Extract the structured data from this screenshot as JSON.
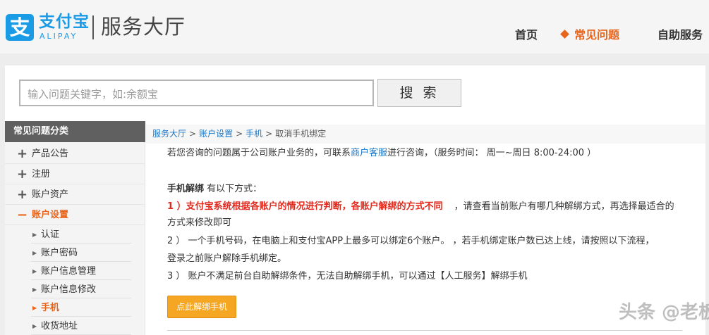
{
  "header": {
    "logo_mark": "支",
    "logo_cn": "支付宝",
    "logo_en": "ALIPAY",
    "title": "服务大厅",
    "nav": {
      "home": "首页",
      "faq": "常见问题",
      "self_service": "自助服务"
    }
  },
  "search": {
    "placeholder": "输入问题关键字，如:余额宝",
    "button": "搜 索"
  },
  "sidebar": {
    "heading": "常见问题分类",
    "items": [
      {
        "icon": "plus-icon",
        "mark": "+",
        "label": "产品公告"
      },
      {
        "icon": "plus-icon",
        "mark": "+",
        "label": "注册"
      },
      {
        "icon": "plus-icon",
        "mark": "+",
        "label": "账户资产"
      },
      {
        "icon": "minus-icon",
        "mark": "−",
        "label": "账户设置"
      }
    ],
    "sub_items": [
      {
        "mark": "▶",
        "label": "认证"
      },
      {
        "mark": "▶",
        "label": "账户密码"
      },
      {
        "mark": "▶",
        "label": "账户信息管理"
      },
      {
        "mark": "▶",
        "label": "账户信息修改"
      },
      {
        "mark": "▶",
        "label": "手机"
      },
      {
        "mark": "▶",
        "label": "收货地址"
      }
    ]
  },
  "breadcrumb": {
    "items": [
      "服务大厅",
      "账户设置",
      "手机",
      "取消手机绑定"
    ],
    "separator": ">"
  },
  "article": {
    "intro_before": "若您咨询的问题属于公司账户业务的，可联系",
    "intro_link": "商户客服",
    "intro_after": "进行咨询，（服务时间： 周一~周日 8:00-24:00 ）",
    "unbind_heading": "手机解绑",
    "unbind_heading_suffix": " 有以下方式：",
    "p1_red": "1 ）支付宝系统根据各账户的情况进行判断，各账户解绑的方式不同",
    "p1_rest": "，请查看当前账户有哪几种解绑方式，再选择最适合的",
    "p1_line2": "方式来修改即可",
    "p2_line1": "2 ） 一个手机号码，在电脑上和支付宝APP上最多可以绑定6个账户。 ，若手机绑定账户数已达上线，请按照以下流程，",
    "p2_line2": "登录之前账户解除手机绑定。",
    "p3": "3 ） 账户不满足前台自助解绑条件，无法自助解绑手机，可以通过【人工服务】解绑手机",
    "button": "点此解绑手机"
  },
  "watermark": "头条 @老板",
  "colors": {
    "brand_blue": "#1a9be6",
    "accent_orange": "#e8641b",
    "alert_red": "#e12a1d",
    "button_orange": "#f5a623",
    "link_blue": "#1a76c6"
  }
}
